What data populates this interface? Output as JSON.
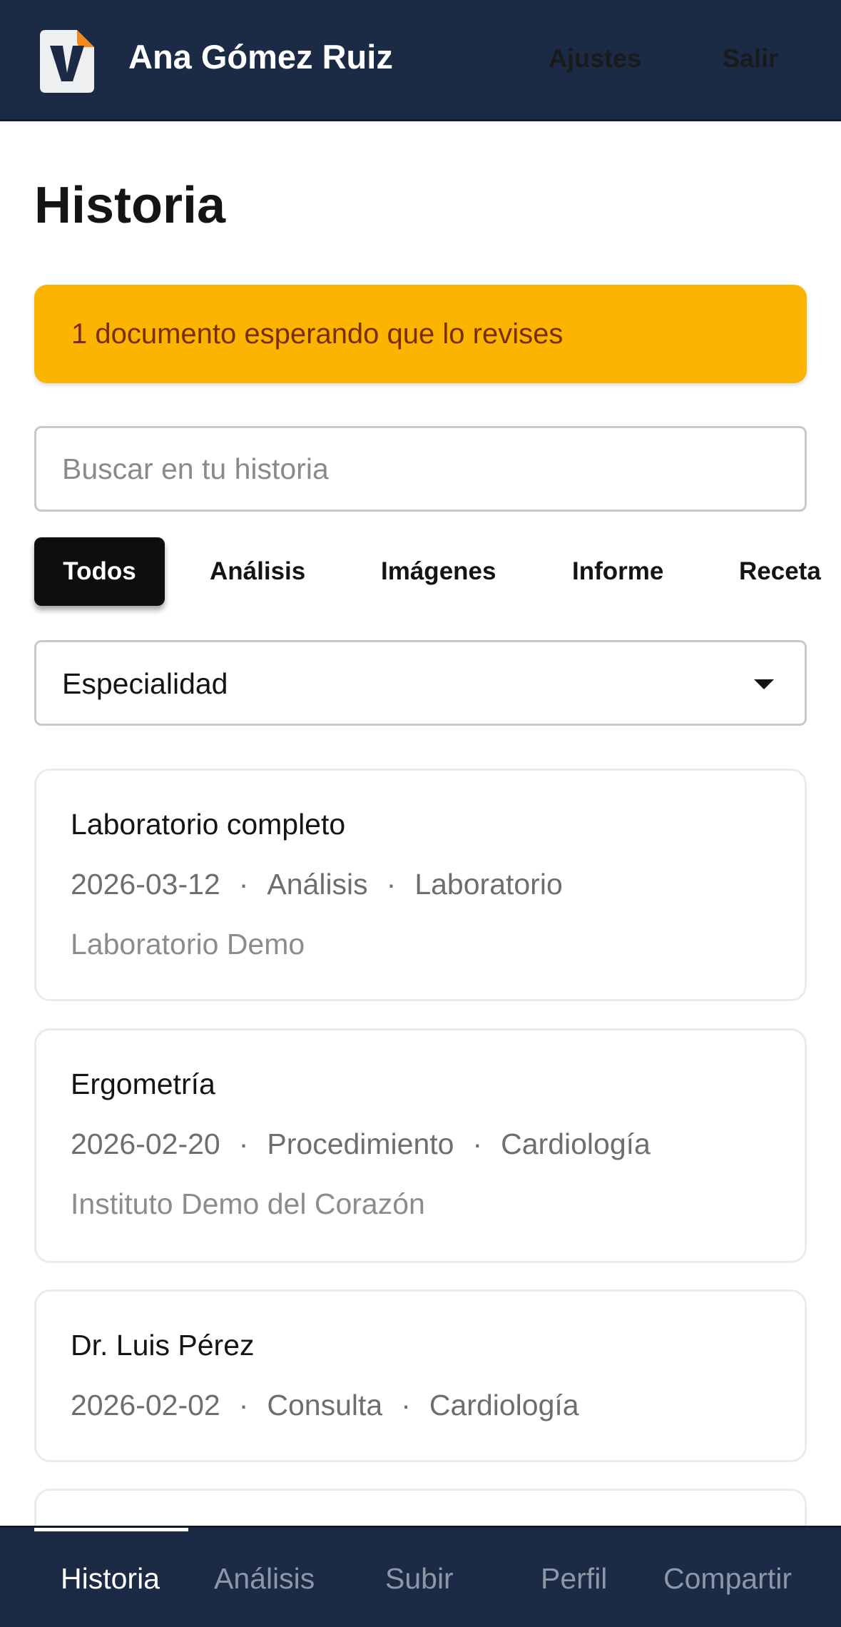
{
  "header": {
    "logo_icon": "app-logo-v-icon",
    "user_name": "Ana Gómez Ruiz",
    "settings_label": "Ajustes",
    "logout_label": "Salir",
    "background": "#1b2a45"
  },
  "page": {
    "title": "Historia"
  },
  "banner": {
    "text": "1 documento esperando que lo revises",
    "color": "#fbb400"
  },
  "search": {
    "placeholder": "Buscar en tu historia",
    "value": ""
  },
  "filters": {
    "selected": "Todos",
    "chips": [
      {
        "label": "Todos"
      },
      {
        "label": "Análisis"
      },
      {
        "label": "Imágenes"
      },
      {
        "label": "Informe"
      },
      {
        "label": "Receta"
      }
    ]
  },
  "specialty_select": {
    "label": "Especialidad",
    "icon": "caret-down-icon"
  },
  "records": [
    {
      "title": "Laboratorio completo",
      "date": "2026-03-12",
      "type": "Análisis",
      "specialty": "Laboratorio",
      "place": "Laboratorio Demo"
    },
    {
      "title": "Ergometría",
      "date": "2026-02-20",
      "type": "Procedimiento",
      "specialty": "Cardiología",
      "place": "Instituto Demo del Corazón"
    },
    {
      "title": "Dr. Luis Pérez",
      "date": "2026-02-02",
      "type": "Consulta",
      "specialty": "Cardiología"
    }
  ],
  "meta_separator": "·",
  "bottom_nav": {
    "active": "Historia",
    "items": [
      {
        "label": "Historia"
      },
      {
        "label": "Análisis"
      },
      {
        "label": "Subir"
      },
      {
        "label": "Perfil"
      },
      {
        "label": "Compartir"
      }
    ]
  }
}
